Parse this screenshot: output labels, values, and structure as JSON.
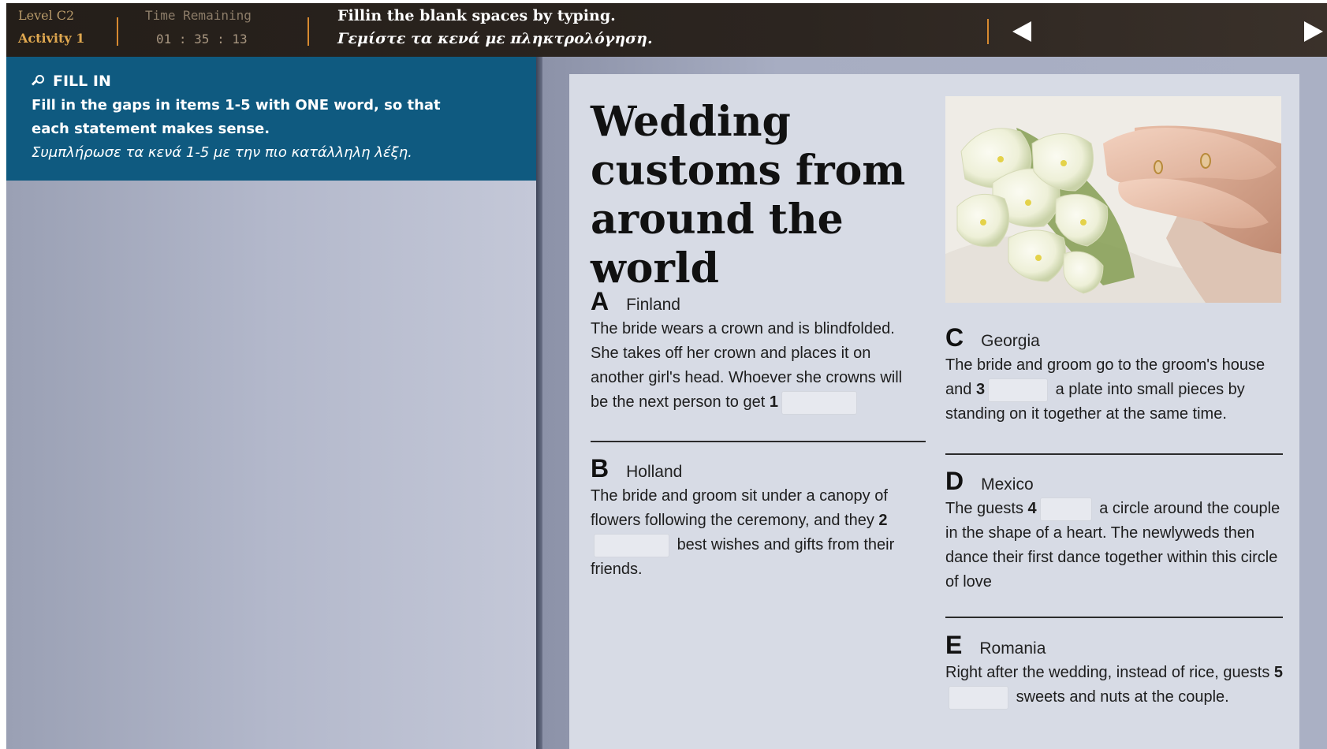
{
  "header": {
    "level": "Level C2",
    "activity": "Activity 1",
    "time_label": "Time Remaining",
    "time_value": "01 : 35 : 13",
    "instruction_en": "Fillin the blank spaces by typing.",
    "instruction_gr": "Γεμίστε τα κενά με πληκτρολόγηση."
  },
  "task": {
    "title": "FILL IN",
    "instruction_en": "Fill in the gaps in items 1-5 with ONE word, so that each statement makes sense.",
    "instruction_gr": "Συμπλήρωσε τα κενά 1-5 με την πιο κατάλληλη λέξη."
  },
  "article": {
    "title": "Wedding customs from around the world",
    "sections": [
      {
        "letter": "A",
        "country": "Finland",
        "text_before": "The bride wears a crown and is blindfolded. She takes off her crown and places it on another girl's head. Whoever she crowns will be the next person to get",
        "gap_number": "1",
        "gap_value": "",
        "text_after": ""
      },
      {
        "letter": "B",
        "country": "Holland",
        "text_before": "The bride and groom sit under a canopy of flowers following the ceremony, and they",
        "gap_number": "2",
        "gap_value": "",
        "text_after": "best wishes and gifts from their friends."
      },
      {
        "letter": "C",
        "country": "Georgia",
        "text_before": "The bride and groom go to the groom's house and",
        "gap_number": "3",
        "gap_value": "",
        "text_after": "a plate into small pieces by standing on it together at the same time."
      },
      {
        "letter": "D",
        "country": "Mexico",
        "text_before": "The guests",
        "gap_number": "4",
        "gap_value": "",
        "text_after": "a circle around the couple in the shape of a heart.  The newlyweds then dance their first dance together within this circle of love"
      },
      {
        "letter": "E",
        "country": "Romania",
        "text_before": "Right after the wedding, instead of rice, guests",
        "gap_number": "5",
        "gap_value": "",
        "text_after": "sweets and nuts at the couple."
      }
    ]
  },
  "icons": {
    "search": "magnifier-icon",
    "prev": "arrow-left-icon",
    "next": "arrow-right-icon"
  },
  "colors": {
    "accent_orange": "#d88a30",
    "panel_blue": "#0f5a80",
    "page_bg": "#d7dbe5"
  }
}
